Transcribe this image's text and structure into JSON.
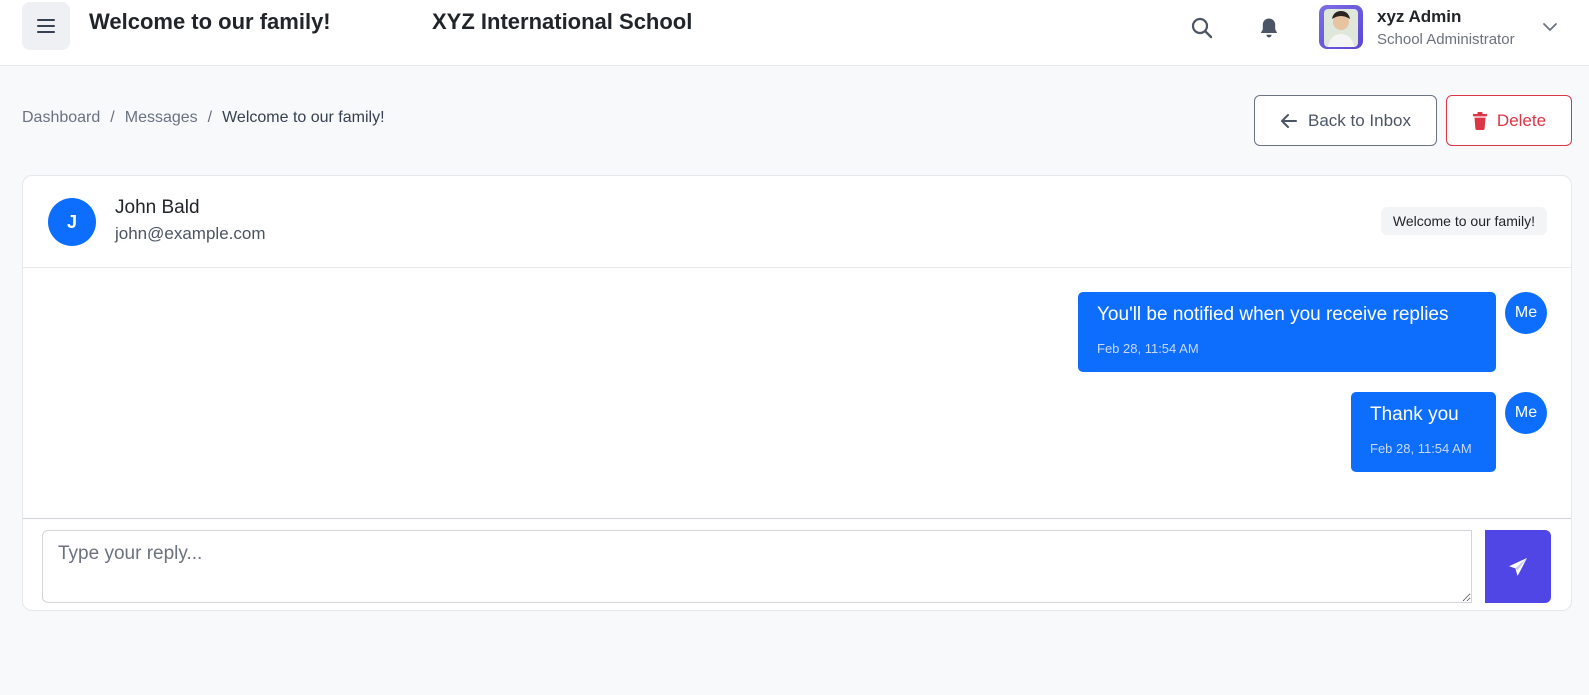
{
  "header": {
    "page_title": "Welcome to our family!",
    "school_name": "XYZ International School",
    "user": {
      "name": "xyz Admin",
      "role": "School Administrator"
    },
    "icons": {
      "menu": "hamburger-icon",
      "search": "search-icon",
      "notifications": "bell-icon",
      "caret": "chevron-down-icon"
    }
  },
  "breadcrumb": {
    "items": [
      "Dashboard",
      "Messages",
      "Welcome to our family!"
    ],
    "separator": "/"
  },
  "actions": {
    "back_label": "Back to Inbox",
    "delete_label": "Delete"
  },
  "conversation": {
    "sender": {
      "initial": "J",
      "name": "John Bald",
      "email": "john@example.com"
    },
    "subject": "Welcome to our family!",
    "messages": [
      {
        "author": "Me",
        "text": "You'll be notified when you receive replies",
        "time": "Feb 28, 11:54 AM"
      },
      {
        "author": "Me",
        "text": "Thank you",
        "time": "Feb 28, 11:54 AM"
      }
    ]
  },
  "reply": {
    "placeholder": "Type your reply...",
    "value": ""
  },
  "colors": {
    "primary": "#0d6efd",
    "danger": "#dc3545",
    "send": "#5046e5"
  }
}
